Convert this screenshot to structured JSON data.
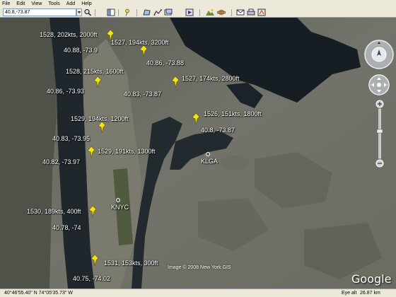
{
  "menu": [
    "File",
    "Edit",
    "View",
    "Tools",
    "Add",
    "Help"
  ],
  "search": {
    "value": "40.8,-73.87"
  },
  "toolbar_icons": [
    "search-icon",
    "sidebar-icon",
    "placemark-icon",
    "polygon-icon",
    "path-icon",
    "overlay-icon",
    "tour-icon",
    "sky-icon",
    "email-icon",
    "print-icon",
    "maps-icon"
  ],
  "placemarks": [
    {
      "id": "a",
      "label": "1528, 202kts, 2000ft",
      "coord": "40.88, -73.9"
    },
    {
      "id": "b",
      "label": "1527, 194kts, 3200ft",
      "coord": "40.86, -73.88"
    },
    {
      "id": "c",
      "label": "1528, 215kts, 1600ft",
      "coord": "40.86, -73.93"
    },
    {
      "id": "d",
      "label": "1527, 174kts, 2800ft",
      "coord": "40.83, -73.87"
    },
    {
      "id": "e",
      "label": "1526, 151kts, 1800ft",
      "coord": "40.8, -73.87"
    },
    {
      "id": "f",
      "label": "1529, 194kts, 1200ft",
      "coord": "40.83, -73.95"
    },
    {
      "id": "g",
      "label": "1529, 191kts, 1300ft",
      "coord": "40.82, -73.97"
    },
    {
      "id": "h",
      "label": "1530, 189kts, 400ft",
      "coord": "40.78, -74"
    },
    {
      "id": "i",
      "label": "1531, 153kts, 300ft",
      "coord": "40.75, -74.02"
    }
  ],
  "airports": {
    "klga": "KLGA",
    "knyc": "KNYC"
  },
  "credit": "Image © 2008 New York GIS",
  "logo": "Google",
  "status": {
    "coords": "40°46'55.40\" N    74°05'35.73\" W",
    "eye_alt_label": "Eye alt",
    "eye_alt": "26.87 km"
  },
  "colors": {
    "water": "#1b2229",
    "land": "#6d6e64",
    "pin": "#f2e41a"
  }
}
